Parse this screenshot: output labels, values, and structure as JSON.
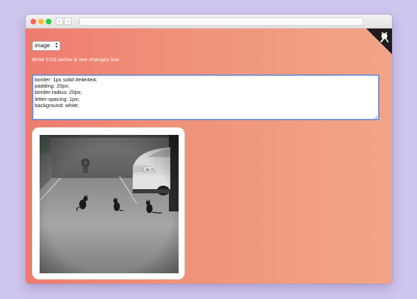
{
  "browser": {
    "back_glyph": "‹",
    "forward_glyph": "›",
    "icons": [
      "close-dot",
      "minimize-dot",
      "zoom-dot",
      "github-icon"
    ]
  },
  "controls": {
    "element_select_value": "image",
    "select_arrows": "▲\n▼"
  },
  "hint_text": "Write CSS below & see changes live.",
  "css_editor": {
    "value": "border: 1px solid #e4e4e4;\npadding: 20px;\nborder-radius: 20px;\nletter-spacing: 1px;\nbackground: white;"
  },
  "photo": {
    "plate_text": "48-79"
  },
  "colors": {
    "gradient_start": "#ef7b6f",
    "gradient_end": "#f2a586",
    "corner_fill": "#1c1c1c",
    "editor_border": "#7a8fd0"
  }
}
